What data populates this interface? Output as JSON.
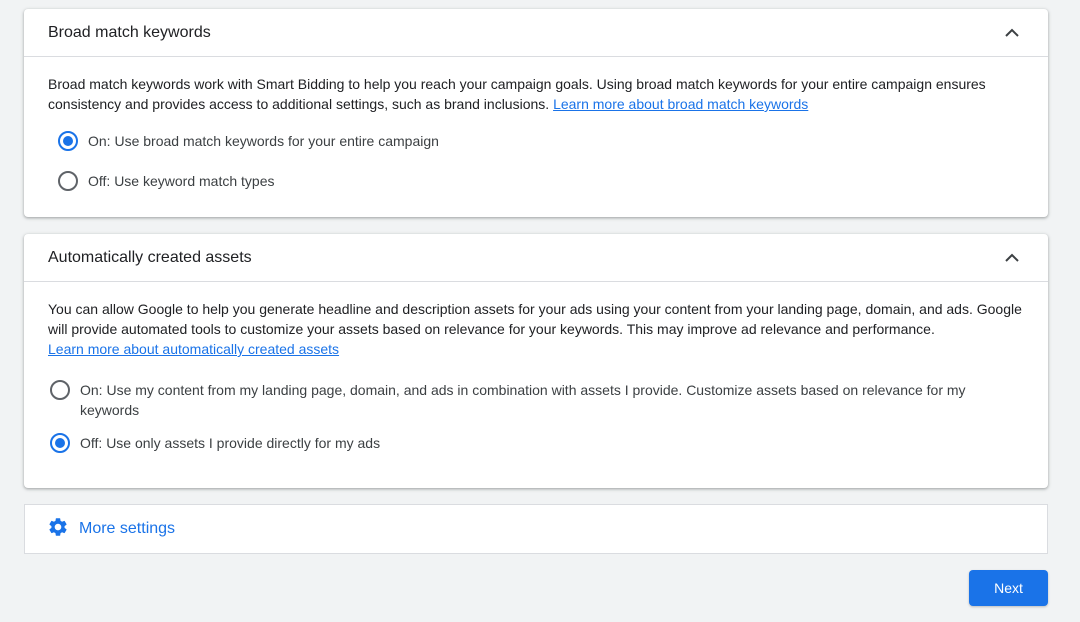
{
  "broad_match": {
    "title": "Broad match keywords",
    "description": "Broad match keywords work with Smart Bidding to help you reach your campaign goals. Using broad match keywords for your entire campaign ensures consistency and provides access to additional settings, such as brand inclusions. ",
    "link": "Learn more about broad match keywords",
    "options": [
      {
        "label": "On: Use broad match keywords for your entire campaign",
        "selected": true
      },
      {
        "label": "Off: Use keyword match types",
        "selected": false
      }
    ],
    "collapse_icon": "chevron-up-icon"
  },
  "auto_assets": {
    "title": "Automatically created assets",
    "description": "You can allow Google to help you generate headline and description assets for your ads using your content from your landing page, domain, and ads. Google will provide automated tools to customize your assets based on relevance for your keywords. This may improve ad relevance and performance.",
    "link": "Learn more about automatically created assets",
    "options": [
      {
        "label": "On: Use my content from my landing page, domain, and ads in combination with assets I provide. Customize assets based on relevance for my keywords",
        "selected": false
      },
      {
        "label": "Off: Use only assets I provide directly for my ads",
        "selected": true
      }
    ],
    "collapse_icon": "chevron-up-icon"
  },
  "more_settings": {
    "label": "More settings",
    "icon": "gear-icon"
  },
  "footer": {
    "next_label": "Next"
  },
  "colors": {
    "accent": "#1a73e8",
    "background": "#f1f3f4"
  }
}
